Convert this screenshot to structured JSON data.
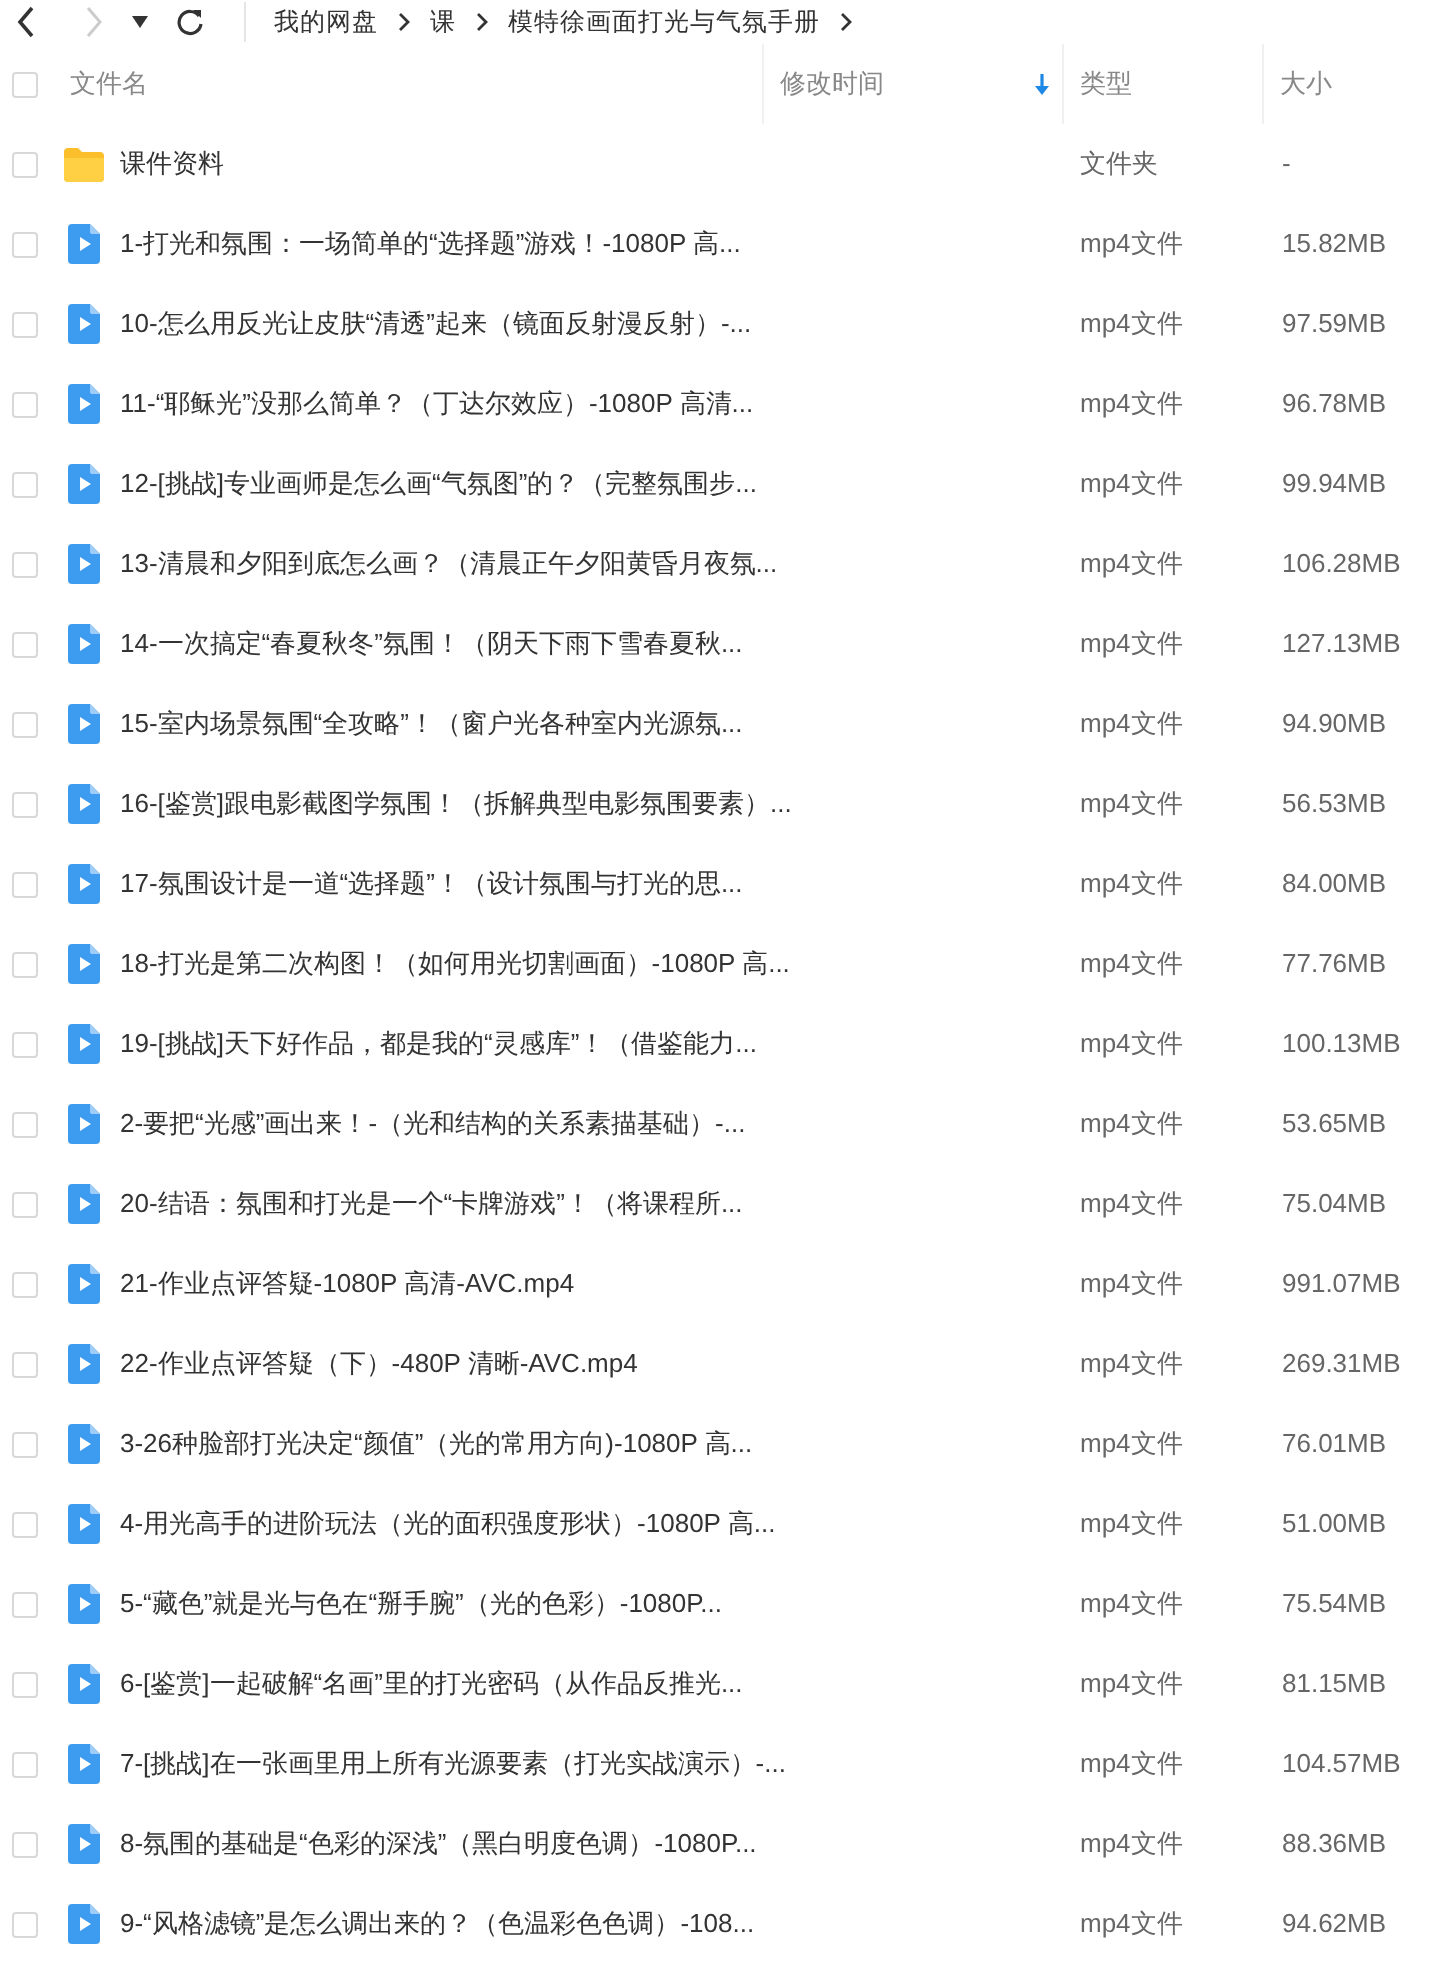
{
  "nav": {
    "back_disabled": false,
    "forward_disabled": true
  },
  "breadcrumb": [
    "我的网盘",
    "课",
    "模特徐画面打光与气氛手册"
  ],
  "select_all": {
    "checked": false
  },
  "columns": [
    {
      "label": "文件名"
    },
    {
      "label": "修改时间",
      "sorted": true
    },
    {
      "label": "类型"
    },
    {
      "label": "大小"
    }
  ],
  "rows": [
    {
      "kind": "folder",
      "name": "课件资料",
      "type": "文件夹",
      "size": "-",
      "checked": false
    },
    {
      "kind": "video",
      "name": "1-打光和氛围：一场简单的“选择题”游戏！-1080P 高...",
      "type": "mp4文件",
      "size": "15.82MB",
      "checked": false
    },
    {
      "kind": "video",
      "name": "10-怎么用反光让皮肤“清透”起来（镜面反射漫反射）-...",
      "type": "mp4文件",
      "size": "97.59MB",
      "checked": false
    },
    {
      "kind": "video",
      "name": "11-“耶稣光”没那么简单？（丁达尔效应）-1080P 高清...",
      "type": "mp4文件",
      "size": "96.78MB",
      "checked": false
    },
    {
      "kind": "video",
      "name": "12-[挑战]专业画师是怎么画“气氛图”的？（完整氛围步...",
      "type": "mp4文件",
      "size": "99.94MB",
      "checked": false
    },
    {
      "kind": "video",
      "name": "13-清晨和夕阳到底怎么画？（清晨正午夕阳黄昏月夜氛...",
      "type": "mp4文件",
      "size": "106.28MB",
      "checked": false
    },
    {
      "kind": "video",
      "name": "14-一次搞定“春夏秋冬”氛围！（阴天下雨下雪春夏秋...",
      "type": "mp4文件",
      "size": "127.13MB",
      "checked": false
    },
    {
      "kind": "video",
      "name": "15-室内场景氛围“全攻略”！（窗户光各种室内光源氛...",
      "type": "mp4文件",
      "size": "94.90MB",
      "checked": false
    },
    {
      "kind": "video",
      "name": "16-[鉴赏]跟电影截图学氛围！（拆解典型电影氛围要素）...",
      "type": "mp4文件",
      "size": "56.53MB",
      "checked": false
    },
    {
      "kind": "video",
      "name": "17-氛围设计是一道“选择题”！（设计氛围与打光的思...",
      "type": "mp4文件",
      "size": "84.00MB",
      "checked": false
    },
    {
      "kind": "video",
      "name": "18-打光是第二次构图！（如何用光切割画面）-1080P 高...",
      "type": "mp4文件",
      "size": "77.76MB",
      "checked": false
    },
    {
      "kind": "video",
      "name": "19-[挑战]天下好作品，都是我的“灵感库”！（借鉴能力...",
      "type": "mp4文件",
      "size": "100.13MB",
      "checked": false
    },
    {
      "kind": "video",
      "name": "2-要把“光感”画出来！-（光和结构的关系素描基础）-...",
      "type": "mp4文件",
      "size": "53.65MB",
      "checked": false
    },
    {
      "kind": "video",
      "name": "20-结语：氛围和打光是一个“卡牌游戏”！（将课程所...",
      "type": "mp4文件",
      "size": "75.04MB",
      "checked": false
    },
    {
      "kind": "video",
      "name": "21-作业点评答疑-1080P 高清-AVC.mp4",
      "type": "mp4文件",
      "size": "991.07MB",
      "checked": false
    },
    {
      "kind": "video",
      "name": "22-作业点评答疑（下）-480P 清晰-AVC.mp4",
      "type": "mp4文件",
      "size": "269.31MB",
      "checked": false
    },
    {
      "kind": "video",
      "name": "3-26种脸部打光决定“颜值”（光的常用方向)-1080P 高...",
      "type": "mp4文件",
      "size": "76.01MB",
      "checked": false
    },
    {
      "kind": "video",
      "name": "4-用光高手的进阶玩法（光的面积强度形状）-1080P 高...",
      "type": "mp4文件",
      "size": "51.00MB",
      "checked": false
    },
    {
      "kind": "video",
      "name": "5-“藏色”就是光与色在“掰手腕”（光的色彩）-1080P...",
      "type": "mp4文件",
      "size": "75.54MB",
      "checked": false
    },
    {
      "kind": "video",
      "name": "6-[鉴赏]一起破解“名画”里的打光密码（从作品反推光...",
      "type": "mp4文件",
      "size": "81.15MB",
      "checked": false
    },
    {
      "kind": "video",
      "name": "7-[挑战]在一张画里用上所有光源要素（打光实战演示）-...",
      "type": "mp4文件",
      "size": "104.57MB",
      "checked": false
    },
    {
      "kind": "video",
      "name": "8-氛围的基础是“色彩的深浅”（黑白明度色调）-1080P...",
      "type": "mp4文件",
      "size": "88.36MB",
      "checked": false
    },
    {
      "kind": "video",
      "name": "9-“风格滤镜”是怎么调出来的？（色温彩色色调）-108...",
      "type": "mp4文件",
      "size": "94.62MB",
      "checked": false
    }
  ]
}
